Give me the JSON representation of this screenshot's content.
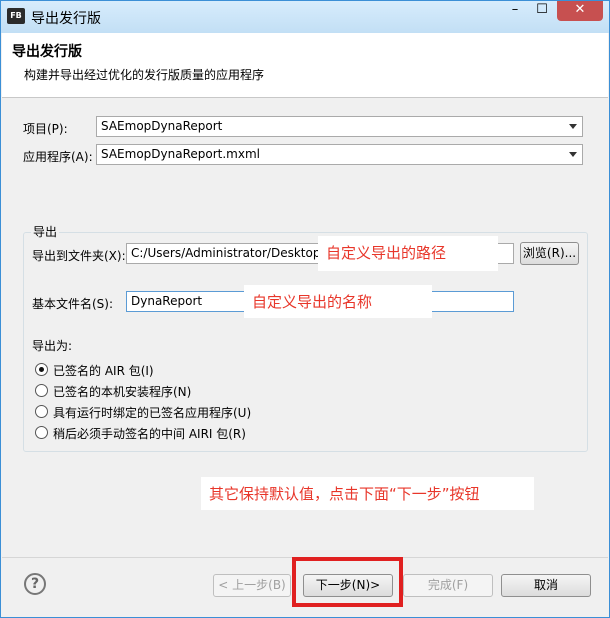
{
  "window": {
    "app_badge": "FB",
    "title": "导出发行版",
    "minimize": "–",
    "maximize": "☐",
    "close": "✕"
  },
  "banner": {
    "title": "导出发行版",
    "description": "构建并导出经过优化的发行版质量的应用程序"
  },
  "project": {
    "label": "项目(P):",
    "value": "SAEmopDynaReport"
  },
  "application": {
    "label": "应用程序(A):",
    "value": "SAEmopDynaReport.mxml"
  },
  "export_group": {
    "legend": "导出",
    "folder_label": "导出到文件夹(X):",
    "folder_value": "C:/Users/Administrator/Desktop",
    "browse_button": "浏览(R)...",
    "basename_label": "基本文件名(S):",
    "basename_value": "DynaReport",
    "export_as_label": "导出为:",
    "options": [
      {
        "label": "已签名的 AIR 包(I)",
        "checked": true
      },
      {
        "label": "已签名的本机安装程序(N)",
        "checked": false
      },
      {
        "label": "具有运行时绑定的已签名应用程序(U)",
        "checked": false
      },
      {
        "label": "稍后必须手动签名的中间 AIRI 包(R)",
        "checked": false
      }
    ]
  },
  "annotations": {
    "path_note": "自定义导出的路径",
    "name_note": "自定义导出的名称",
    "instruction_note": "其它保持默认值，点击下面“下一步”按钮"
  },
  "footer": {
    "help_icon": "?",
    "back_button": "< 上一步(B)",
    "next_button": "下一步(N)>",
    "finish_button": "完成(F)",
    "cancel_button": "取消"
  },
  "colors": {
    "annotation_text": "#e8362a",
    "highlight_border": "#e02020"
  }
}
